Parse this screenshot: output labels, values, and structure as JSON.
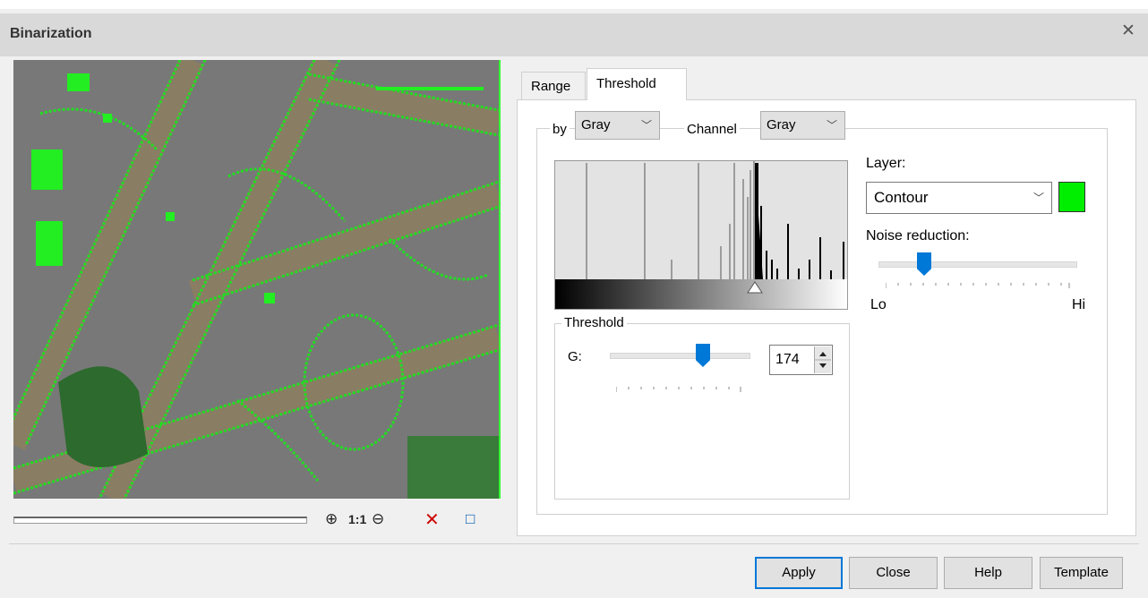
{
  "window": {
    "title": "Binarization",
    "close_glyph": "✕"
  },
  "toolbar": {
    "zoom_in": "⊕",
    "actual_size": "1:1",
    "zoom_out": "⊖",
    "clear": "✕",
    "fit": "□"
  },
  "tabs": [
    {
      "label": "Range",
      "active": false
    },
    {
      "label": "Threshold",
      "active": true
    }
  ],
  "by": {
    "label": "by",
    "value": "Gray"
  },
  "channel": {
    "label": "Channel",
    "value": "Gray"
  },
  "threshold_group": {
    "title": "Threshold",
    "g_label": "G:",
    "value": "174",
    "slider_fraction": 0.68
  },
  "layer": {
    "label": "Layer:",
    "value": "Contour",
    "color": "#00ee00"
  },
  "noise": {
    "label": "Noise reduction:",
    "lo": "Lo",
    "hi": "Hi",
    "slider_fraction": 0.23
  },
  "buttons": {
    "apply": "Apply",
    "close": "Close",
    "help": "Help",
    "template": "Template"
  },
  "colors": {
    "accent": "#0078d7",
    "contour": "#00ee00"
  }
}
